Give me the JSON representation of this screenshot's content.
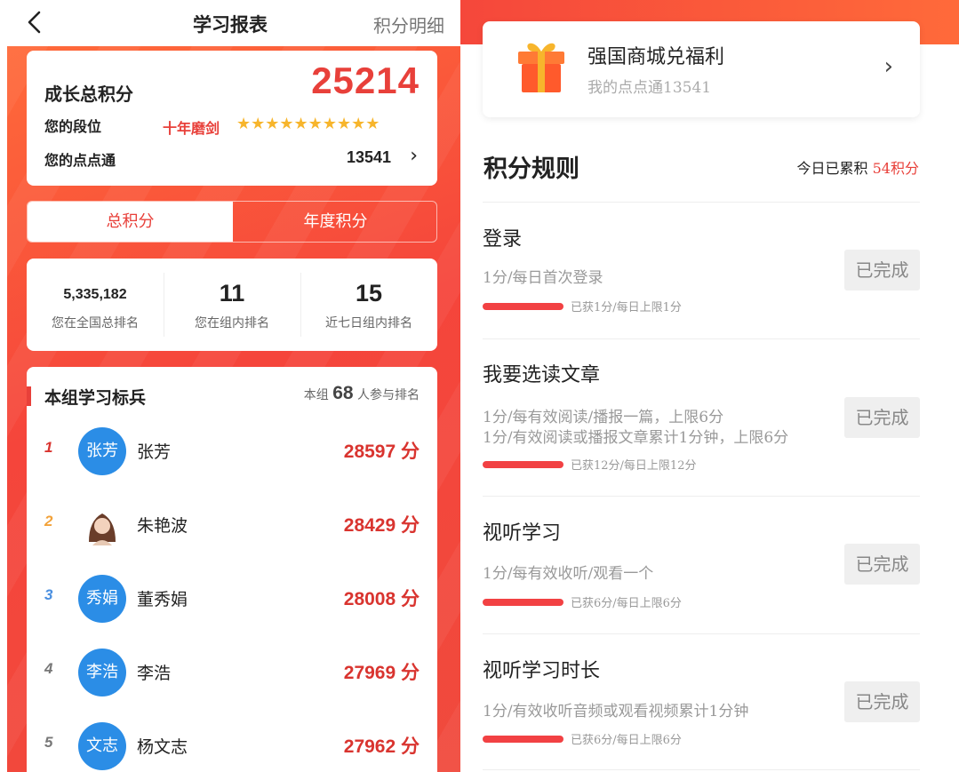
{
  "header": {
    "title": "学习报表",
    "detail_link": "积分明细"
  },
  "score_card": {
    "total_label": "成长总积分",
    "total_value": "25214",
    "rank_label": "您的段位",
    "rank_value": "十年磨剑",
    "stars": "★★★★★★★★★★",
    "ddt_label": "您的点点通",
    "ddt_value": "13541"
  },
  "tabs": [
    {
      "label": "总积分",
      "active": true
    },
    {
      "label": "年度积分",
      "active": false
    }
  ],
  "ranking": [
    {
      "value": "5,335,182",
      "label": "您在全国总排名"
    },
    {
      "value": "11",
      "label": "您在组内排名"
    },
    {
      "value": "15",
      "label": "近七日组内排名"
    }
  ],
  "team": {
    "title": "本组学习标兵",
    "count_prefix": "本组",
    "count": "68",
    "count_suffix": "人参与排名",
    "members": [
      {
        "rank": "1",
        "avatar_text": "张芳",
        "name": "张芳",
        "points": "28597 分",
        "rank_color": "#d9342f"
      },
      {
        "rank": "2",
        "avatar_text": "",
        "name": "朱艳波",
        "points": "28429 分",
        "rank_color": "#f2a23a"
      },
      {
        "rank": "3",
        "avatar_text": "秀娟",
        "name": "董秀娟",
        "points": "28008 分",
        "rank_color": "#4a8fe0"
      },
      {
        "rank": "4",
        "avatar_text": "李浩",
        "name": "李浩",
        "points": "27969 分",
        "rank_color": "#777777"
      },
      {
        "rank": "5",
        "avatar_text": "文志",
        "name": "杨文志",
        "points": "27962 分",
        "rank_color": "#777777"
      }
    ]
  },
  "mall": {
    "title": "强国商城兑福利",
    "subtitle": "我的点点通13541"
  },
  "rules": {
    "title": "积分规则",
    "today_prefix": "今日已累积",
    "today_value": "54积分",
    "items": [
      {
        "title": "登录",
        "desc": [
          "1分/每日首次登录"
        ],
        "progress": "已获1分/每日上限1分",
        "status": "已完成"
      },
      {
        "title": "我要选读文章",
        "desc": [
          "1分/每有效阅读/播报一篇，上限6分",
          "1分/有效阅读或播报文章累计1分钟，上限6分"
        ],
        "progress": "已获12分/每日上限12分",
        "status": "已完成"
      },
      {
        "title": "视听学习",
        "desc": [
          "1分/每有效收听/观看一个"
        ],
        "progress": "已获6分/每日上限6分",
        "status": "已完成"
      },
      {
        "title": "视听学习时长",
        "desc": [
          "1分/有效收听音频或观看视频累计1分钟"
        ],
        "progress": "已获6分/每日上限6分",
        "status": "已完成"
      }
    ]
  }
}
